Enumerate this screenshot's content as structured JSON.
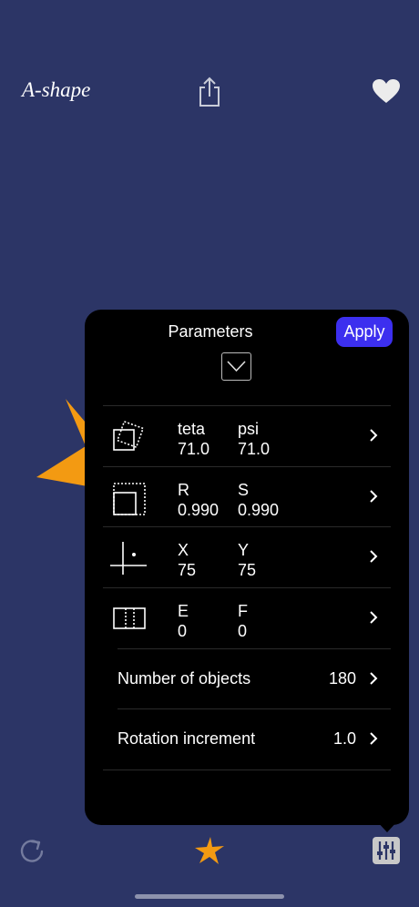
{
  "header": {
    "title": "A-shape",
    "share_icon": "share-icon",
    "favorite_icon": "heart-icon"
  },
  "panel": {
    "title": "Parameters",
    "apply_label": "Apply",
    "collapse_icon": "chevron-down-icon",
    "param_rows": [
      {
        "icon": "rotation-squares-icon",
        "a_label": "teta",
        "a_value": "71.0",
        "b_label": "psi",
        "b_value": "71.0"
      },
      {
        "icon": "scale-square-icon",
        "a_label": "R",
        "a_value": "0.990",
        "b_label": "S",
        "b_value": "0.990"
      },
      {
        "icon": "axis-crosshair-icon",
        "a_label": "X",
        "a_value": "75",
        "b_label": "Y",
        "b_value": "75"
      },
      {
        "icon": "split-rect-icon",
        "a_label": "E",
        "a_value": "0",
        "b_label": "F",
        "b_value": "0"
      }
    ],
    "settings": [
      {
        "label": "Number of objects",
        "value": "180"
      },
      {
        "label": "Rotation increment",
        "value": "1.0"
      }
    ]
  },
  "toolbar": {
    "refresh_icon": "refresh-icon",
    "shape_icon": "star-icon",
    "parameters_icon": "sliders-icon"
  },
  "colors": {
    "background": "#2c3566",
    "panel": "#000000",
    "accent": "#3c2fef",
    "shape": "#f39a12"
  }
}
